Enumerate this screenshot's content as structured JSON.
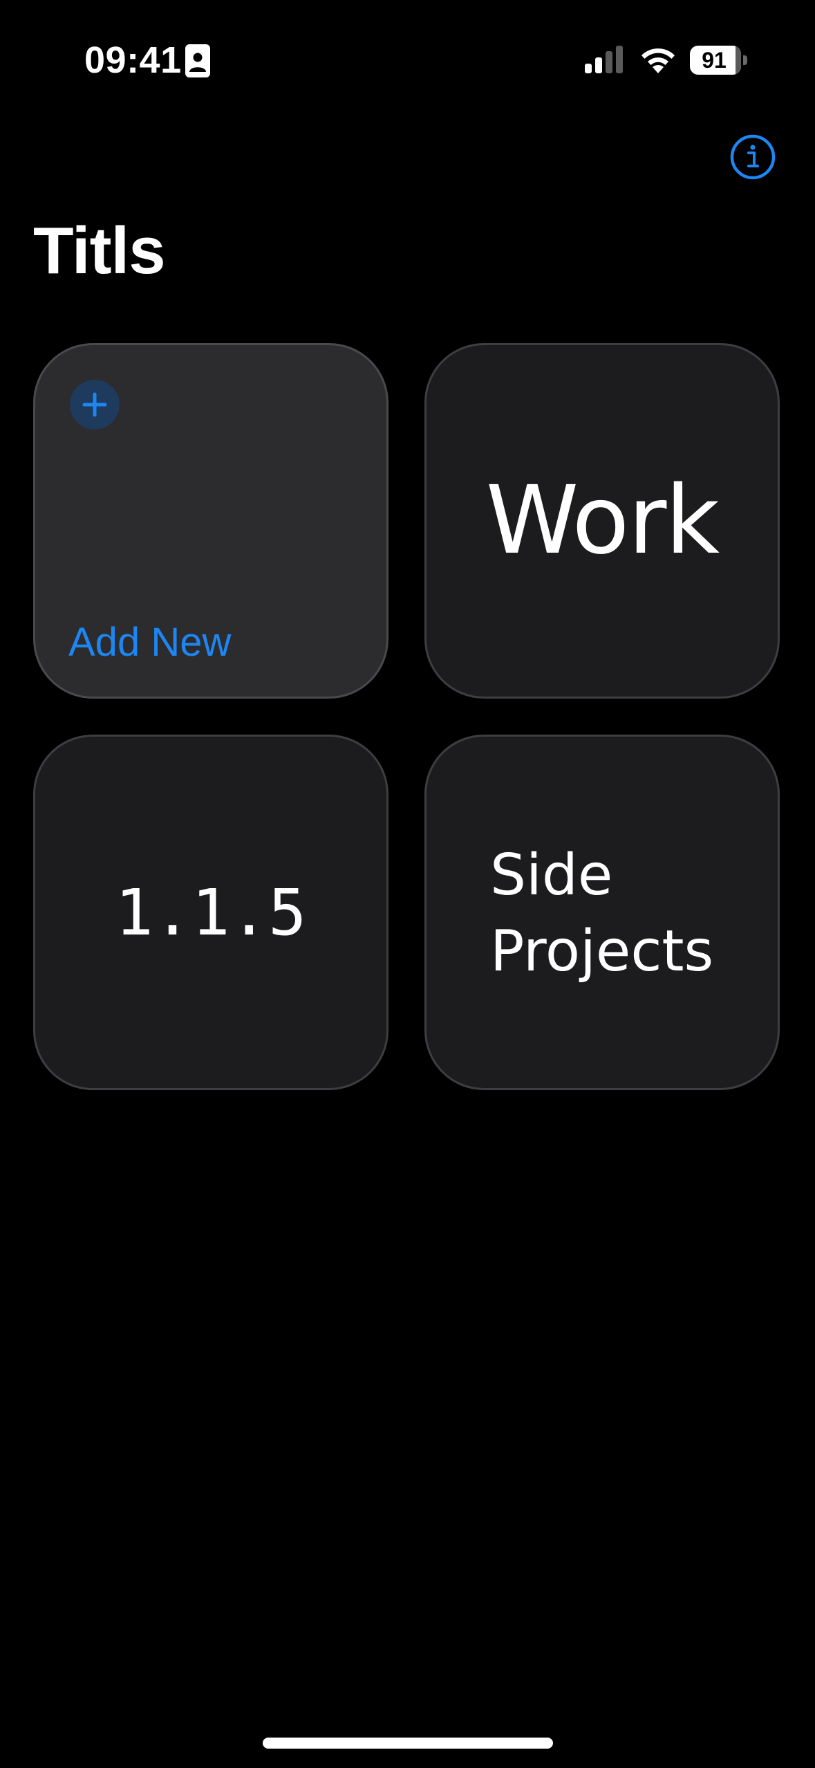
{
  "status_bar": {
    "time": "09:41",
    "battery_level": "91",
    "icons": [
      "contact-card-icon",
      "cellular-signal-icon",
      "wifi-icon",
      "battery-icon"
    ]
  },
  "header": {
    "title": "Titls",
    "info_icon": "info-circle-icon"
  },
  "tiles": {
    "add_new": {
      "label": "Add New",
      "icon": "plus-icon"
    },
    "work": {
      "label": "Work"
    },
    "version": {
      "label": "1.1.5"
    },
    "side_projects": {
      "line1": "Side",
      "line2": "Projects"
    }
  },
  "colors": {
    "accent": "#1e86f2",
    "background": "#000000",
    "tile": "#1c1c1e",
    "tile_add": "#2c2c2e"
  }
}
